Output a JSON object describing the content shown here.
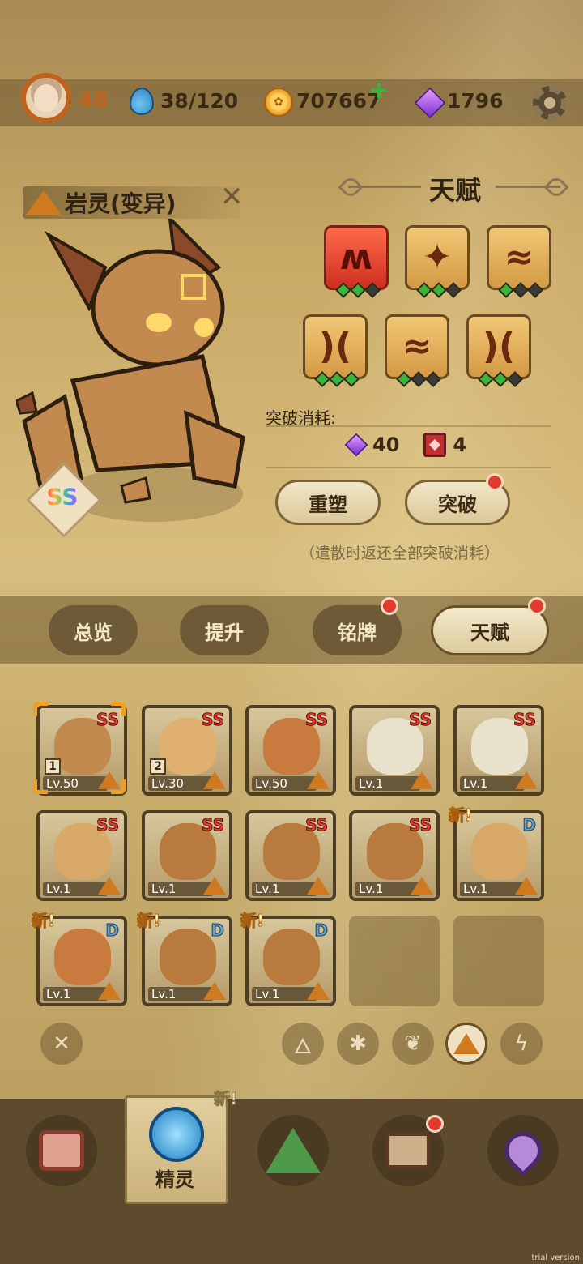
{
  "header": {
    "level": "48",
    "energy": "38/120",
    "coins": "707667",
    "gems": "1796",
    "plus": "+"
  },
  "creature": {
    "name": "岩灵(变异)",
    "rank": "SS"
  },
  "talent": {
    "title": "天赋",
    "cost_label": "突破消耗:",
    "cost_gem": "40",
    "cost_book": "4",
    "reset_label": "重塑",
    "break_label": "突破",
    "note": "（遣散时返还全部突破消耗）",
    "icons": [
      {
        "name": "fang",
        "pips": [
          true,
          true,
          false
        ],
        "red": true
      },
      {
        "name": "sparkle",
        "pips": [
          true,
          true,
          false
        ],
        "red": false
      },
      {
        "name": "wave",
        "pips": [
          true,
          false,
          false
        ],
        "red": false
      },
      {
        "name": "crescent",
        "pips": [
          true,
          true,
          true
        ],
        "red": false
      },
      {
        "name": "wave",
        "pips": [
          true,
          false,
          false
        ],
        "red": false
      },
      {
        "name": "crescent",
        "pips": [
          true,
          true,
          false
        ],
        "red": false
      }
    ]
  },
  "tabs": [
    {
      "label": "总览"
    },
    {
      "label": "提升"
    },
    {
      "label": "铭牌"
    },
    {
      "label": "天赋"
    }
  ],
  "grid": {
    "slots": [
      {
        "rank": "SS",
        "lv": "Lv.50",
        "num": "1",
        "selected": true,
        "creature": "rock"
      },
      {
        "rank": "SS",
        "lv": "Lv.30",
        "num": "2",
        "creature": "potato"
      },
      {
        "rank": "SS",
        "lv": "Lv.50",
        "creature": "dog"
      },
      {
        "rank": "SS",
        "lv": "Lv.1",
        "creature": "skull"
      },
      {
        "rank": "SS",
        "lv": "Lv.1",
        "creature": "skull"
      },
      {
        "rank": "SS",
        "lv": "Lv.1",
        "creature": "blob"
      },
      {
        "rank": "SS",
        "lv": "Lv.1",
        "creature": "dragon"
      },
      {
        "rank": "SS",
        "lv": "Lv.1",
        "creature": "dragon"
      },
      {
        "rank": "SS",
        "lv": "Lv.1",
        "creature": "dragon"
      },
      {
        "rank": "D",
        "lv": "Lv.1",
        "new": "新!",
        "creature": "blob"
      },
      {
        "rank": "D",
        "lv": "Lv.1",
        "new": "新!",
        "creature": "dog"
      },
      {
        "rank": "D",
        "lv": "Lv.1",
        "new": "新!",
        "creature": "dragon"
      },
      {
        "rank": "D",
        "lv": "Lv.1",
        "new": "新!",
        "creature": "dragon"
      }
    ]
  },
  "filters": [
    "close-icon",
    "fire-icon",
    "flower-icon",
    "leaf-icon",
    "earth-icon",
    "lightning-icon"
  ],
  "nav": {
    "active_label": "精灵",
    "new_tag": "新!",
    "items": [
      "battle-icon",
      "spirit-icon",
      "mountain-icon",
      "chest-icon",
      "map-pin-icon"
    ]
  },
  "watermark": "trial version",
  "colors": {
    "accent_orange": "#c0621c",
    "alert_red": "#e23b2e",
    "pip_green": "#3ab53a"
  }
}
